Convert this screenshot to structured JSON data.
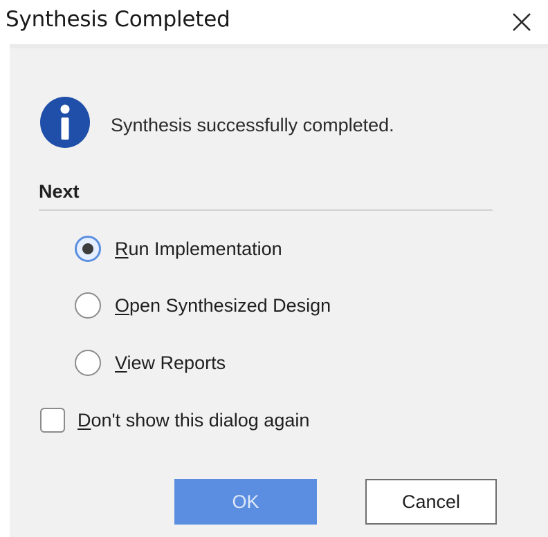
{
  "window": {
    "title": "Synthesis Completed",
    "close_icon": "close-icon"
  },
  "message": {
    "icon": "info-icon",
    "text": "Synthesis successfully completed."
  },
  "next_section": {
    "heading": "Next",
    "options": [
      {
        "mnemonic": "R",
        "rest": "un Implementation",
        "selected": true
      },
      {
        "mnemonic": "O",
        "rest": "pen Synthesized Design",
        "selected": false
      },
      {
        "mnemonic": "V",
        "rest": "iew Reports",
        "selected": false
      }
    ]
  },
  "dont_show": {
    "mnemonic": "D",
    "rest": "on't show this dialog again",
    "checked": false
  },
  "buttons": {
    "ok_label": "OK",
    "cancel_label": "Cancel"
  },
  "colors": {
    "accent": "#5b8ee0",
    "info_icon": "#1f4fa8",
    "panel_bg": "#f1f1f1"
  }
}
